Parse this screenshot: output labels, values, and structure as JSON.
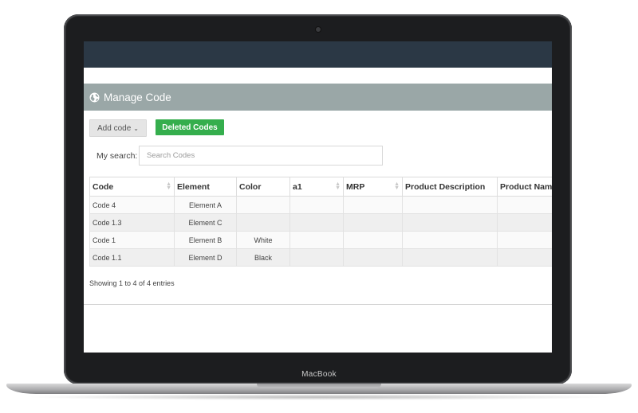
{
  "device": {
    "brand": "MacBook"
  },
  "panel": {
    "title": "Manage Code",
    "icon": "globe-icon"
  },
  "toolbar": {
    "add_code_label": "Add code",
    "deleted_codes_label": "Deleted Codes"
  },
  "search": {
    "label": "My search:",
    "placeholder": "Search Codes",
    "value": ""
  },
  "table": {
    "columns": [
      "Code",
      "Element",
      "Color",
      "a1",
      "MRP",
      "Product Description",
      "Product Name"
    ],
    "rows": [
      [
        "Code 4",
        "Element A",
        "",
        "",
        "",
        "",
        ""
      ],
      [
        "Code 1.3",
        "Element C",
        "",
        "",
        "",
        "",
        ""
      ],
      [
        "Code 1",
        "Element B",
        "White",
        "",
        "",
        "",
        ""
      ],
      [
        "Code 1.1",
        "Element D",
        "Black",
        "",
        "",
        "",
        ""
      ]
    ]
  },
  "info": "Showing 1 to 4 of 4 entries",
  "colors": {
    "topbar": "#2b3845",
    "header": "#9aa7a7",
    "accent_green": "#35ae4d"
  }
}
